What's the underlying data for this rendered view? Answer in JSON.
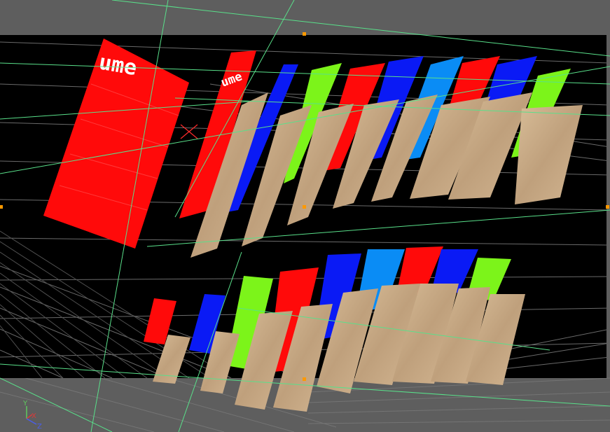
{
  "viewport": {
    "background_color": "#5e5e5e",
    "safe_frame_color": "#000000",
    "grid_color": "#7a7a7a",
    "guide_color": "#59e08a",
    "handle_color": "#ff9900"
  },
  "scene": {
    "panel_text_large": "ume",
    "panel_text_small": "ume",
    "colors": {
      "red": "#ff0a0a",
      "blue": "#0a1af5",
      "green": "#7cf41a",
      "sky": "#0a8cf5",
      "paper": "#c9ab86"
    }
  },
  "axis_gizmo": {
    "x_label": "X",
    "y_label": "Y",
    "z_label": "Z",
    "x_color": "#d83a3a",
    "y_color": "#5ec95e",
    "z_color": "#4a5ee8"
  }
}
